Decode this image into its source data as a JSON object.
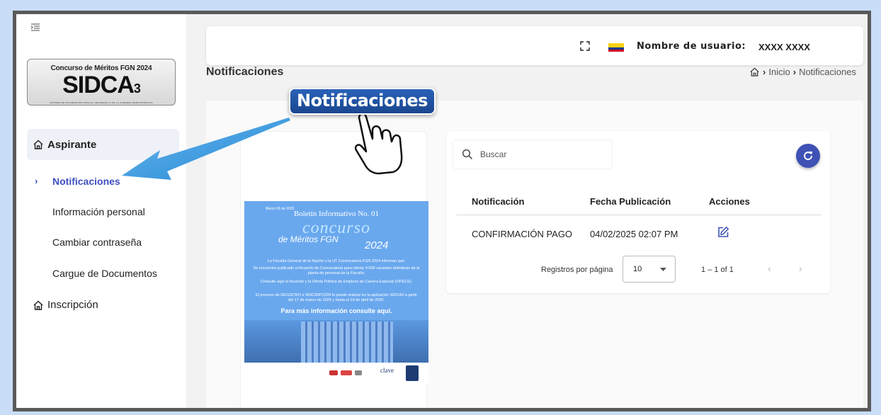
{
  "sidebar": {
    "logo": {
      "top_text": "Concurso de Méritos FGN 2024",
      "main_text": "SIDCA",
      "main_suffix": "3",
      "sub_text": "SISTEMA DE INFORMACIÓN PARA EL DESARROLLO DE LA CARRERA ADMINISTRATIVA"
    },
    "group_label": "Aspirante",
    "items": [
      {
        "label": "Notificaciones",
        "active": true
      },
      {
        "label": "Información personal"
      },
      {
        "label": "Cambiar contraseña"
      },
      {
        "label": "Cargue de Documentos"
      }
    ],
    "inscripcion_label": "Inscripción"
  },
  "header": {
    "user_label": "Nombre de usuario:",
    "user_name": "XXXX XXXX"
  },
  "page": {
    "title": "Notificaciones",
    "breadcrumb": [
      "Inicio",
      "Notificaciones"
    ]
  },
  "callout": {
    "label": "Notificaciones"
  },
  "poster": {
    "date": "Marzo 06 de 2025",
    "boletin": "Boletín Informativo No. 01",
    "concurso": "concurso",
    "meritos": "de Méritos FGN",
    "year": "2024",
    "p1": "La Fiscalía General de la Nación y la UT Convocatoria FGN 2024 informan que:",
    "p2": "Se encuentra publicado el Acuerdo de Convocatoria para ofertar 4.000 vacantes definitivas de la planta de personal de la Fiscalía.",
    "p3": "Consulte aquí el Acuerdo y la Oferta Pública de Empleos de Carrera Especial (OPECE).",
    "p4": "El proceso de REGISTRO e INSCRIPCIÓN lo puede realizar en la aplicación SIDCA3 a partir del 17 de marzo de 2025 y hasta el 14 de abril de 2025.",
    "more": "Para más información consulte aquí.",
    "footer_brand": "clave"
  },
  "table": {
    "search_placeholder": "Buscar",
    "columns": [
      "Notificación",
      "Fecha Publicación",
      "Acciones"
    ],
    "rows": [
      {
        "notificacion": "CONFIRMACIÓN PAGO",
        "fecha": "04/02/2025 02:07 PM"
      }
    ],
    "pager": {
      "label": "Registros por página",
      "page_size": "10",
      "range": "1 – 1 of 1"
    }
  },
  "colors": {
    "accent": "#3f51b5",
    "active_nav": "#3f4fbf",
    "callout_bg": "#1a468f",
    "arrow": "#2a8fd8",
    "frame_border": "#5a5a5a",
    "backdrop": "#c9ddf6"
  },
  "icons": [
    "collapse-icon",
    "home-icon",
    "fullscreen-icon",
    "colombia-flag-icon",
    "search-icon",
    "refresh-icon",
    "edit-icon",
    "chevron-down-icon",
    "chevron-left-icon",
    "chevron-right-icon",
    "hand-pointer-icon",
    "arrow-icon"
  ]
}
